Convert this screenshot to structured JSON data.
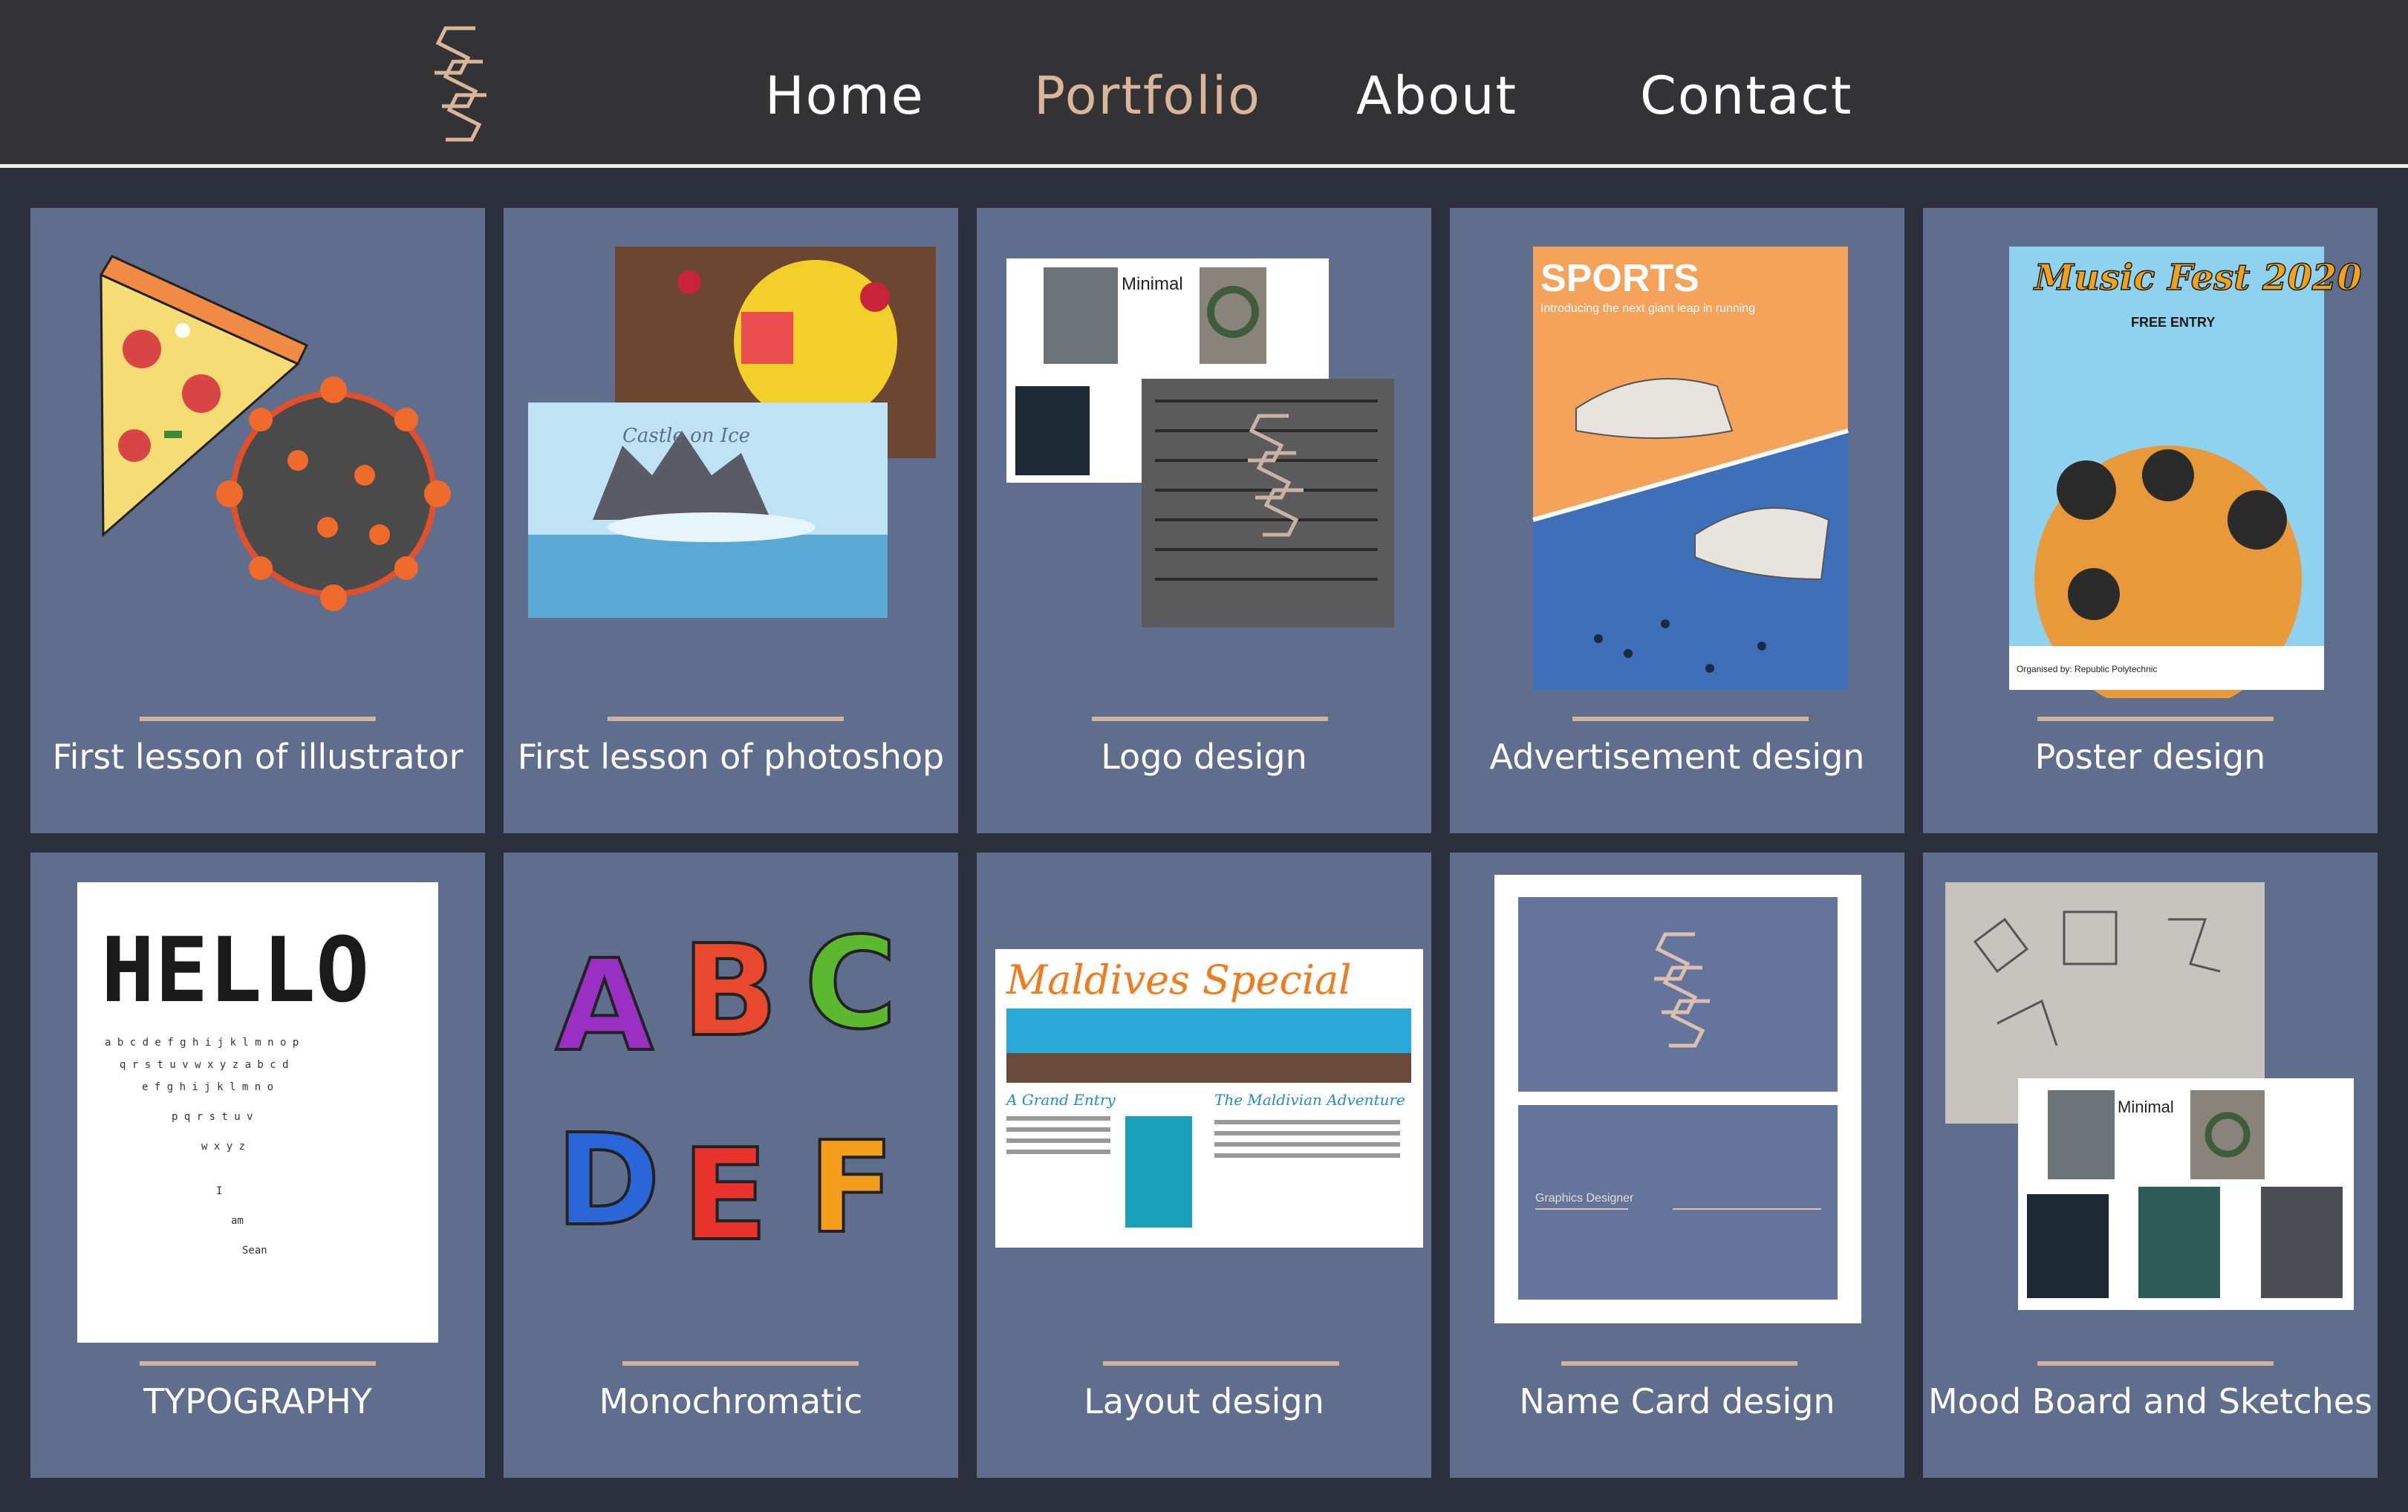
{
  "nav": {
    "home": "Home",
    "portfolio": "Portfolio",
    "about": "About",
    "contact": "Contact"
  },
  "colors": {
    "nav_bg": "#333335",
    "page_bg": "#2b303c",
    "card_bg": "#5f6e8c",
    "accent": "#d9b69a"
  },
  "cards": [
    {
      "caption": "First lesson of illustrator"
    },
    {
      "caption": "First lesson of photoshop",
      "thumb_text": "Castle on Ice"
    },
    {
      "caption": "Logo design",
      "thumb_text": "Minimal"
    },
    {
      "caption": "Advertisement design",
      "thumb_text": "SPORTS",
      "thumb_subtext": "Introducing the next giant leap in running"
    },
    {
      "caption": "Poster design",
      "thumb_text": "Music Fest 2020",
      "thumb_subtext": "FREE ENTRY",
      "thumb_footer": "Organised by: Republic Polytechnic"
    },
    {
      "caption": "TYPOGRAPHY",
      "thumb_text": "HELLO"
    },
    {
      "caption": "Monochromatic",
      "letters": [
        "A",
        "B",
        "C",
        "D",
        "E",
        "F"
      ]
    },
    {
      "caption": "Layout design",
      "thumb_text": "Maldives Special",
      "thumb_subtext_a": "A Grand Entry",
      "thumb_subtext_b": "The Maldivian Adventure"
    },
    {
      "caption": "Name Card design",
      "thumb_text": "Graphics Designer"
    },
    {
      "caption": "Mood Board and Sketches",
      "thumb_text": "Minimal"
    }
  ]
}
